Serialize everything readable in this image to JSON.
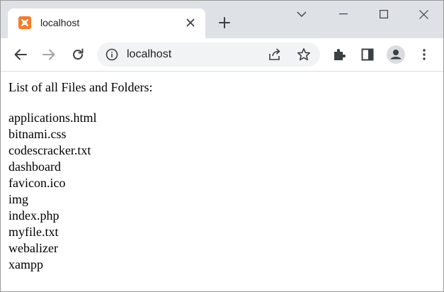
{
  "browser": {
    "tab": {
      "title": "localhost",
      "favicon": "xampp-icon"
    },
    "address_bar": {
      "url": "localhost"
    },
    "colors": {
      "tabstrip": "#dee1e6",
      "favicon": "#fb7a24",
      "omnibox": "#f1f3f4"
    }
  },
  "page": {
    "heading": "List of all Files and Folders:",
    "items": [
      "applications.html",
      "bitnami.css",
      "codescracker.txt",
      "dashboard",
      "favicon.ico",
      "img",
      "index.php",
      "myfile.txt",
      "webalizer",
      "xampp"
    ]
  }
}
